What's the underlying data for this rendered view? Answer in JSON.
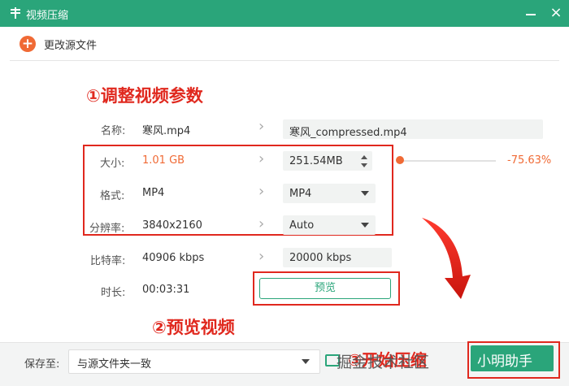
{
  "window": {
    "title": "视频压缩"
  },
  "toolbar": {
    "add_source_label": "更改源文件"
  },
  "annotations": {
    "step1": "①调整视频参数",
    "step2": "②预览视频",
    "step3": "③开始压缩"
  },
  "rows": {
    "name": {
      "label": "名称:",
      "source": "寒风.mp4",
      "output": "寒风_compressed.mp4"
    },
    "size": {
      "label": "大小:",
      "source": "1.01 GB",
      "output": "251.54MB"
    },
    "format": {
      "label": "格式:",
      "source": "MP4",
      "output": "MP4"
    },
    "resolution": {
      "label": "分辨率:",
      "source": "3840x2160",
      "output": "Auto"
    },
    "bitrate": {
      "label": "比特率:",
      "source": "40906 kbps",
      "output": "20000 kbps"
    },
    "duration": {
      "label": "时长:",
      "source": "00:03:31"
    }
  },
  "slider": {
    "percent_text": "-75.63%"
  },
  "preview_button": "预览",
  "bottom": {
    "save_to_label": "保存至:",
    "save_to_value": "与源文件夹一致",
    "start_button": "小明助手"
  },
  "watermark": "掘金技术社区",
  "colors": {
    "accent_green": "#2aa57a",
    "accent_orange": "#f06a35",
    "annotation_red": "#e0281e"
  },
  "icons": [
    "app-icon",
    "minimize-icon",
    "close-icon",
    "add-icon",
    "chevron-right-icon",
    "stepper-icon",
    "dropdown-icon",
    "folder-icon",
    "red-arrow"
  ]
}
